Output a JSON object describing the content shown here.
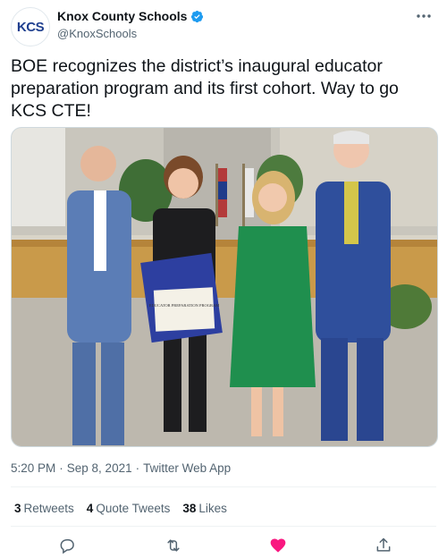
{
  "account": {
    "display_name": "Knox County Schools",
    "handle": "@KnoxSchools",
    "avatar_text": "KCS",
    "verified": true
  },
  "tweet": {
    "text": "BOE recognizes the district’s inaugural educator preparation program and its first cohort. Way to go KCS CTE!",
    "time": "5:20 PM",
    "date": "Sep 8, 2021",
    "source": "Twitter Web App",
    "separator": "·"
  },
  "stats": {
    "retweets_count": "3",
    "retweets_label": "Retweets",
    "quote_count": "4",
    "quote_label": "Quote Tweets",
    "likes_count": "38",
    "likes_label": "Likes"
  },
  "photo": {
    "certificate_title": "EDUCATOR PREPARATION PROGRAM"
  },
  "icons": {
    "verified": "verified-badge-icon",
    "more": "more-dots-icon",
    "reply": "reply-icon",
    "retweet": "retweet-icon",
    "like": "heart-icon",
    "share": "share-icon"
  },
  "colors": {
    "brand_blue": "#1d9bf0",
    "like_pink": "#f91880",
    "avatar_navy": "#1f3f8f",
    "secondary_text": "#536471"
  }
}
